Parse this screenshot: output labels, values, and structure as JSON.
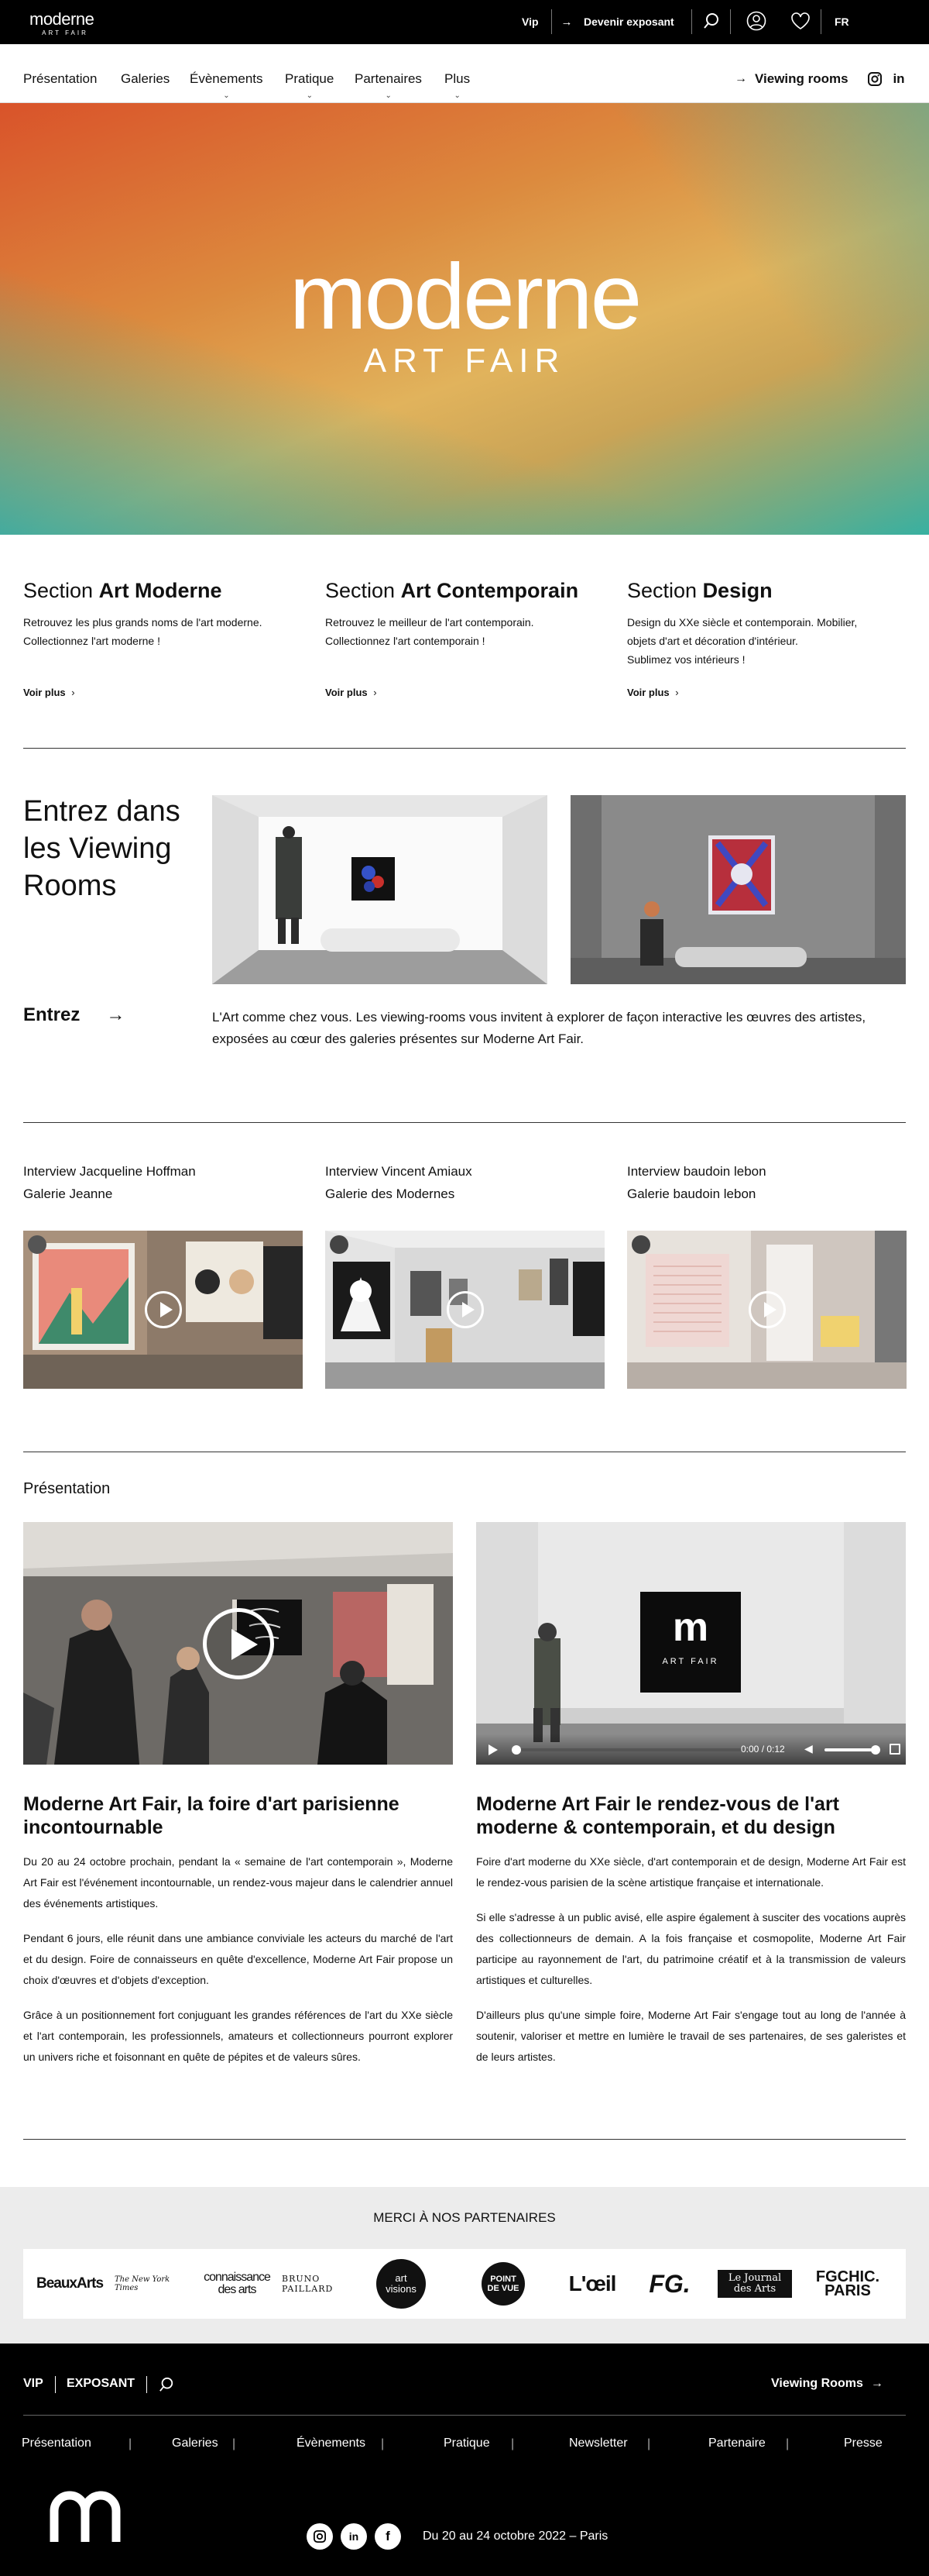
{
  "topbar": {
    "logo_word": "moderne",
    "logo_sub": "ART FAIR",
    "vip": "Vip",
    "exhibitor": "Devenir exposant",
    "lang": "FR"
  },
  "nav": {
    "items": [
      "Présentation",
      "Galeries",
      "Évènements",
      "Pratique",
      "Partenaires",
      "Plus"
    ],
    "viewing_rooms": "Viewing rooms",
    "social": [
      "instagram-icon",
      "linkedin-icon"
    ]
  },
  "hero": {
    "logo_word": "moderne",
    "logo_sub": "ART FAIR"
  },
  "sections": [
    {
      "prefix": "Section ",
      "title": "Art Moderne",
      "text": [
        "Retrouvez les plus grands noms de l'art moderne.",
        "Collectionnez l'art moderne !"
      ],
      "more": "Voir plus"
    },
    {
      "prefix": "Section ",
      "title": "Art Contemporain",
      "text": [
        "Retrouvez le meilleur de l'art contemporain.",
        "Collectionnez l'art contemporain !"
      ],
      "more": "Voir plus"
    },
    {
      "prefix": "Section ",
      "title": "Design",
      "text": [
        "Design du XXe siècle et contemporain. Mobilier,",
        "objets d'art et décoration d'intérieur.",
        "Sublimez vos intérieurs !"
      ],
      "more": "Voir plus"
    }
  ],
  "viewing_rooms": {
    "title": "Entrez dans les Viewing Rooms",
    "cta": "Entrez",
    "text": "L'Art comme chez vous. Les viewing-rooms vous invitent à explorer de façon interactive les œuvres des artistes, exposées au cœur des galeries présentes sur Moderne Art Fair."
  },
  "interviews": [
    {
      "title": "Interview Jacqueline Hoffman",
      "gallery": "Galerie Jeanne"
    },
    {
      "title": "Interview Vincent Amiaux",
      "gallery": "Galerie des Modernes"
    },
    {
      "title": "Interview baudoin lebon",
      "gallery": "Galerie baudoin lebon"
    }
  ],
  "presentation": {
    "heading": "Présentation",
    "video_time": "0:00 / 0:12",
    "video2_logo": "ART FAIR",
    "articles": [
      {
        "title": "Moderne Art Fair, la foire d'art parisienne incontournable",
        "paragraphs": [
          "Du 20 au 24 octobre prochain, pendant la « semaine de l'art contemporain », Moderne Art Fair est l'événement incontournable, un rendez-vous majeur dans le calendrier annuel des événements artistiques.",
          "Pendant 6 jours, elle réunit dans une ambiance conviviale les acteurs du marché de l'art et du design. Foire de connaisseurs en quête d'excellence, Moderne Art Fair propose un choix d'œuvres et d'objets d'exception.",
          "Grâce à un positionnement fort conjuguant les grandes références de l'art du XXe siècle et l'art contemporain, les professionnels, amateurs et collectionneurs pourront explorer un univers riche et foisonnant en quête de pépites et de valeurs sûres."
        ]
      },
      {
        "title": "Moderne Art Fair le rendez-vous de l'art moderne & contemporain, et du design",
        "paragraphs": [
          "Foire d'art moderne du XXe siècle, d'art contemporain et de design, Moderne Art Fair est le rendez-vous parisien de la scène artistique française et internationale.",
          "Si elle s'adresse à un public avisé, elle aspire également à susciter des vocations auprès des collectionneurs de demain. A la fois française et cosmopolite, Moderne Art Fair participe au rayonnement de l'art, du patrimoine créatif et à la transmission de valeurs artistiques et culturelles.",
          "D'ailleurs plus qu'une simple foire, Moderne Art Fair s'engage tout au long de l'année à soutenir, valoriser et mettre en lumière le travail de ses partenaires, de ses galeristes et de leurs artistes."
        ]
      }
    ]
  },
  "partners": {
    "title": "MERCI À NOS PARTENAIRES",
    "logos": [
      "BeauxArts",
      "The New York Times",
      "connaissance des arts",
      "BRUNO PAILLARD",
      "art visions",
      "POINT DE VUE",
      "L'œil",
      "FG.",
      "Le Journal des Arts",
      "FGCHIC. PARIS"
    ]
  },
  "footer": {
    "vip": "VIP",
    "exposant": "EXPOSANT",
    "viewing_rooms": "Viewing Rooms",
    "links": [
      "Présentation",
      "Galeries",
      "Évènements",
      "Pratique",
      "Newsletter",
      "Partenaire",
      "Presse"
    ],
    "date": "Du 20 au 24 octobre 2022 – Paris"
  },
  "colors": {
    "black": "#000000",
    "accent_gradient": [
      "#d9532a",
      "#e1b35c",
      "#38b0a1"
    ]
  }
}
